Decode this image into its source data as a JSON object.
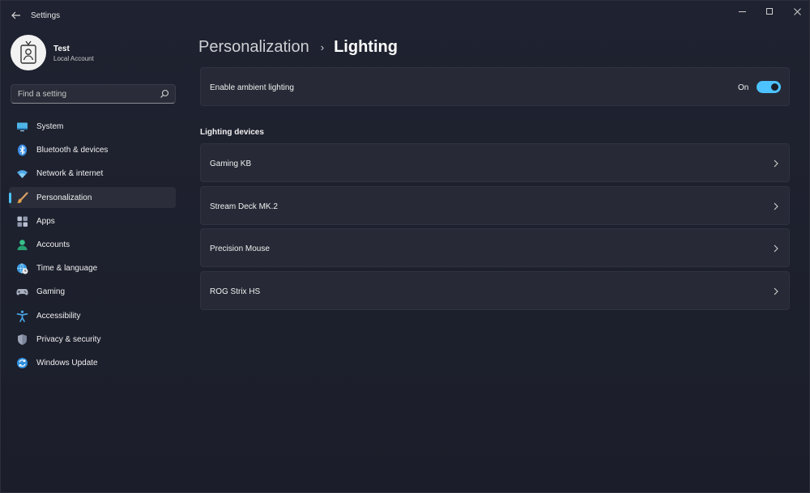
{
  "window": {
    "title": "Settings",
    "back_icon": "arrow-left-icon",
    "controls": [
      "minimize-icon",
      "maximize-icon",
      "close-icon"
    ]
  },
  "user": {
    "name": "Test",
    "account_type": "Local Account",
    "avatar_icon": "user-badge-icon"
  },
  "search": {
    "placeholder": "Find a setting",
    "value": "",
    "icon": "search-icon"
  },
  "nav": {
    "selected": "Personalization",
    "accent_color": "#4cc2ff",
    "items": [
      {
        "label": "System",
        "icon": "monitor-icon"
      },
      {
        "label": "Bluetooth & devices",
        "icon": "bluetooth-icon"
      },
      {
        "label": "Network & internet",
        "icon": "wifi-icon"
      },
      {
        "label": "Personalization",
        "icon": "brush-icon"
      },
      {
        "label": "Apps",
        "icon": "apps-icon"
      },
      {
        "label": "Accounts",
        "icon": "person-icon"
      },
      {
        "label": "Time & language",
        "icon": "globe-clock-icon"
      },
      {
        "label": "Gaming",
        "icon": "gamepad-icon"
      },
      {
        "label": "Accessibility",
        "icon": "accessibility-icon"
      },
      {
        "label": "Privacy & security",
        "icon": "shield-icon"
      },
      {
        "label": "Windows Update",
        "icon": "sync-icon"
      }
    ]
  },
  "breadcrumb": {
    "parent": "Personalization",
    "separator": "›",
    "current": "Lighting"
  },
  "ambient": {
    "label": "Enable ambient lighting",
    "state_label": "On",
    "enabled": true
  },
  "devices": {
    "section_title": "Lighting devices",
    "items": [
      {
        "label": "Gaming KB"
      },
      {
        "label": "Stream Deck MK.2"
      },
      {
        "label": "Precision Mouse"
      },
      {
        "label": "ROG Strix HS"
      }
    ]
  }
}
